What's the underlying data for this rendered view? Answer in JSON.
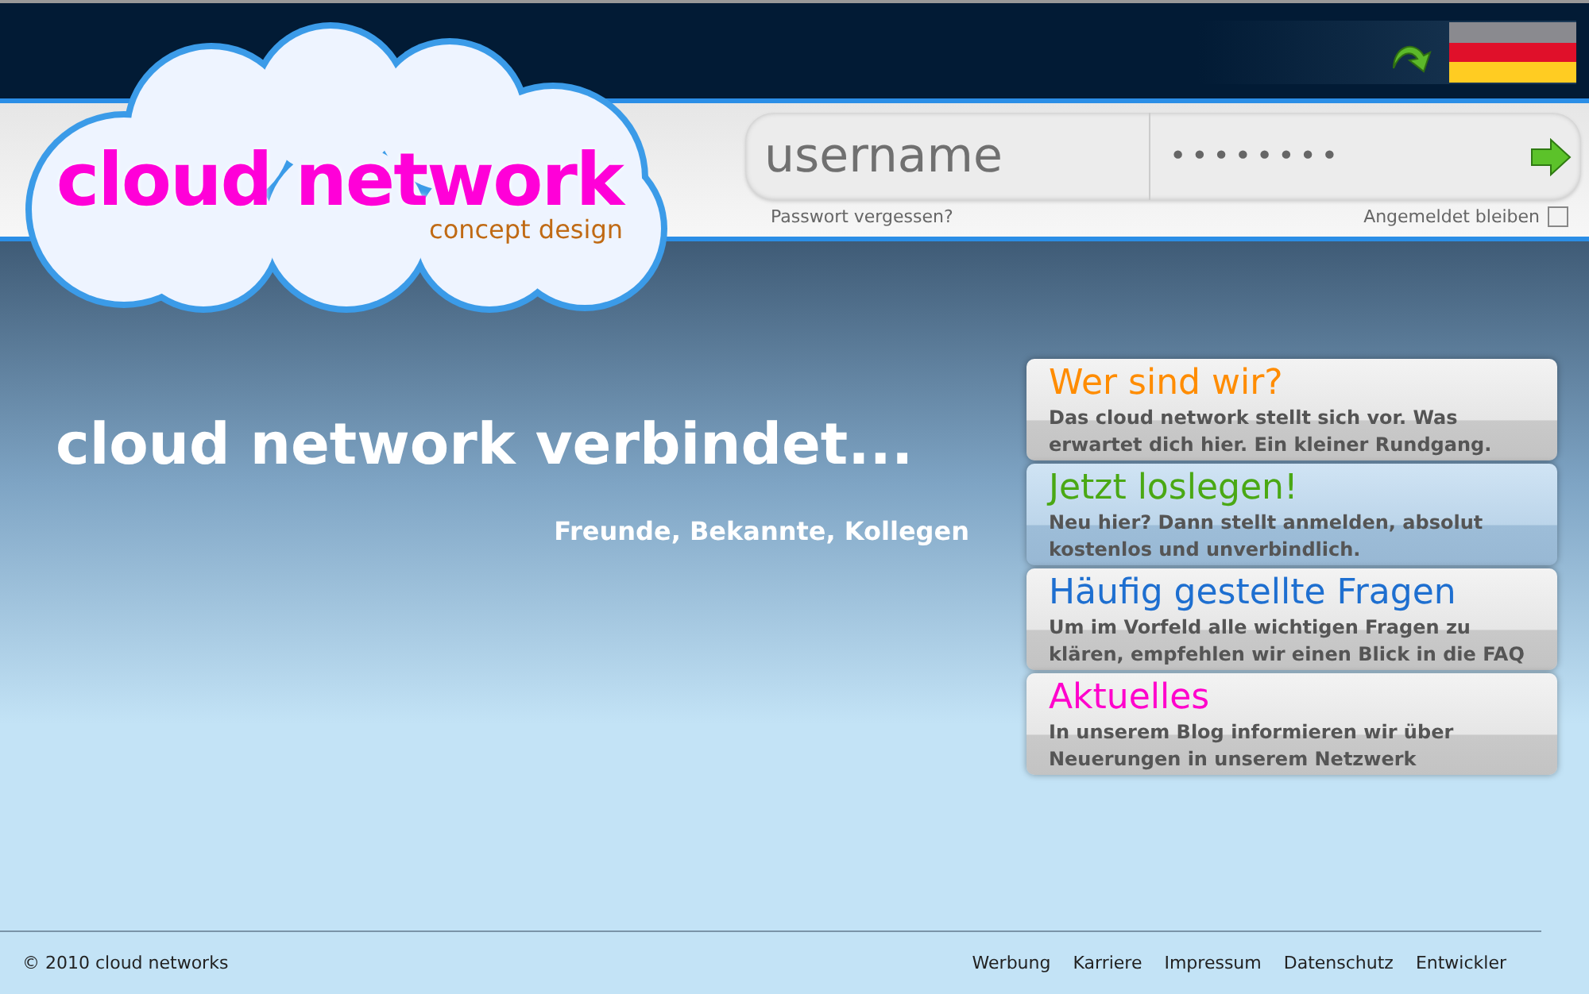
{
  "logo": {
    "title": "cloud network",
    "subtitle": "concept design"
  },
  "login": {
    "username_placeholder": "username",
    "password_value": "••••••••",
    "forgot_link": "Passwort vergessen?",
    "remember_label": "Angemeldet bleiben",
    "remember_checked": false
  },
  "hero": {
    "heading": "cloud network verbindet...",
    "subheading": "Freunde, Bekannte, Kollegen"
  },
  "cards": [
    {
      "title": "Wer sind wir?",
      "text": "Das cloud network stellt sich vor. Was erwartet dich hier. Ein kleiner Rundgang.",
      "color": "#ff8c00",
      "selected": false
    },
    {
      "title": "Jetzt loslegen!",
      "text": "Neu hier? Dann stellt anmelden, absolut kostenlos und unverbindlich.",
      "color": "#4aa814",
      "selected": true
    },
    {
      "title": "Häufig gestellte Fragen",
      "text": "Um im Vorfeld alle wichtigen Fragen zu klären, empfehlen wir einen Blick in die FAQ",
      "color": "#1e6fd0",
      "selected": false
    },
    {
      "title": "Aktuelles",
      "text": "In unserem Blog informieren wir über Neuerungen in unserem Netzwerk",
      "color": "#ff00cc",
      "selected": false
    }
  ],
  "footer": {
    "copyright": "© 2010 cloud networks",
    "links": [
      "Werbung",
      "Karriere",
      "Impressum",
      "Datenschutz",
      "Entwickler"
    ]
  }
}
